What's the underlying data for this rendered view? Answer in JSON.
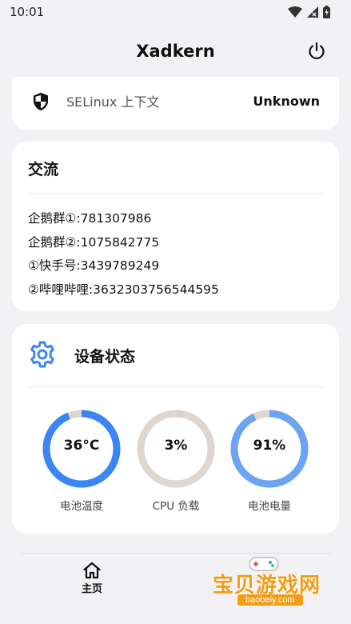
{
  "status_bar": {
    "time": "10:01"
  },
  "app_bar": {
    "title": "Xadkern"
  },
  "selinux": {
    "label": "SELinux 上下文",
    "value": "Unknown"
  },
  "communication": {
    "title": "交流",
    "lines": [
      "企鹅群①:781307986",
      "企鹅群②:1075842775",
      "①快手号:3439789249",
      "②哔哩哔哩:3632303756544595"
    ]
  },
  "device_status": {
    "title": "设备状态",
    "gauges": [
      {
        "value_text": "36°C",
        "label": "电池温度",
        "fraction": 0.94,
        "color": "#3b86f7"
      },
      {
        "value_text": "3%",
        "label": "CPU 负载",
        "fraction": 0.03,
        "color": "#d9d2c9"
      },
      {
        "value_text": "91%",
        "label": "电池电量",
        "fraction": 0.93,
        "color": "#6aa4f3"
      }
    ]
  },
  "bottom_nav": {
    "home_label": "主页"
  },
  "watermark": {
    "text": "宝贝游戏网",
    "url": "baobeiy.com"
  },
  "colors": {
    "accent": "#3b86f7",
    "track": "#ddd7d0",
    "background": "#f2f2f5"
  }
}
